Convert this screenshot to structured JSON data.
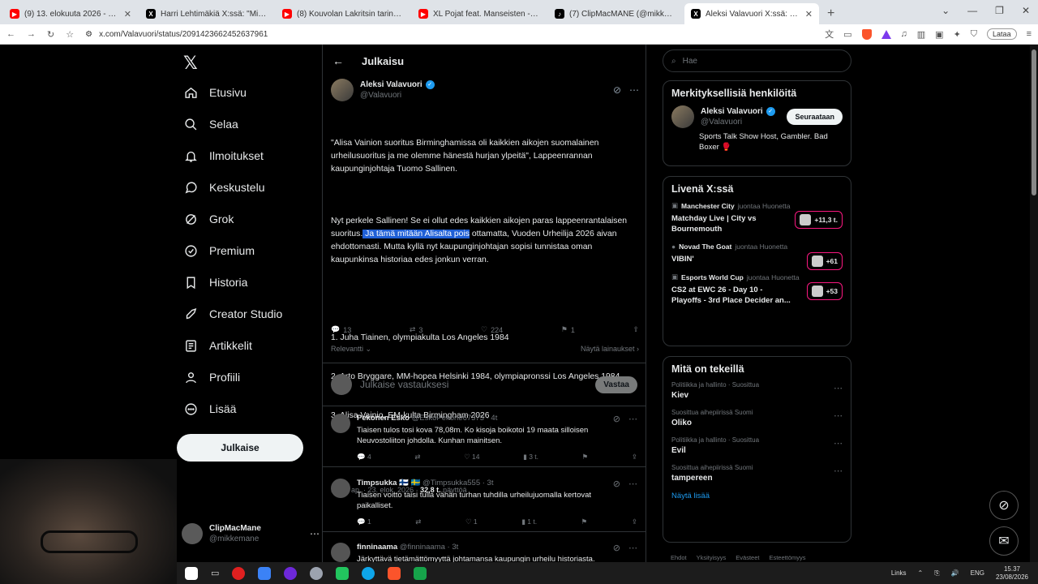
{
  "browser": {
    "tabs": [
      {
        "icon": "youtube-icon",
        "title": "(9) 13. elokuuta 2026 - YouTube",
        "active": false
      },
      {
        "icon": "x-icon",
        "title": "Harri Lehtimäkiä X:ssä: \"Miljoon Su",
        "active": false
      },
      {
        "icon": "youtube-icon",
        "title": "(8) Kouvolan Lakritsin tarina - Tämän",
        "active": false
      },
      {
        "icon": "youtube-icon",
        "title": "XL Pojat feat. Manseisten - aika Pekko",
        "active": false
      },
      {
        "icon": "tiktok-icon",
        "title": "(7) ClipMacMANE (@mikkemane) | Ti",
        "active": false
      },
      {
        "icon": "x-icon",
        "title": "Aleksi Valavuori X:ssä: \"Alisa Va",
        "active": true
      }
    ],
    "url": "x.com/Valavuori/status/2091423662452637961",
    "update_label": "Lataa"
  },
  "nav": {
    "items": [
      {
        "icon": "home-icon",
        "label": "Etusivu"
      },
      {
        "icon": "search-icon",
        "label": "Selaa"
      },
      {
        "icon": "bell-icon",
        "label": "Ilmoitukset"
      },
      {
        "icon": "chat-icon",
        "label": "Keskustelu"
      },
      {
        "icon": "grok-icon",
        "label": "Grok"
      },
      {
        "icon": "premium-icon",
        "label": "Premium"
      },
      {
        "icon": "bookmark-icon",
        "label": "Historia"
      },
      {
        "icon": "rocket-icon",
        "label": "Creator Studio"
      },
      {
        "icon": "article-icon",
        "label": "Artikkelit"
      },
      {
        "icon": "person-icon",
        "label": "Profiili"
      },
      {
        "icon": "more-icon",
        "label": "Lisää"
      }
    ],
    "post_label": "Julkaise",
    "account": {
      "name": "ClipMacMane",
      "handle": "@mikkemane"
    }
  },
  "post": {
    "header": "Julkaisu",
    "author": "Aleksi Valavuori",
    "handle": "@Valavuori",
    "p1": "\"Alisa Vainion suoritus Birminghamissa oli kaikkien aikojen suomalainen urheilusuoritus ja me olemme hänestä hurjan ylpeitä\", Lappeenrannan kaupunginjohtaja Tuomo Sallinen.",
    "p2_a": "Nyt perkele Sallinen! Se ei ollut edes kaikkien aikojen paras lappeenrantalaisen suoritus.",
    "p2_hl": " Ja tämä mitään Alisalta pois",
    "p2_b": " ottamatta, Vuoden Urheilija 2026 aivan ehdottomasti. Mutta kyllä nyt kaupunginjohtajan sopisi tunnistaa oman kaupunkinsa historiaa edes jonkun verran.",
    "list": [
      "1. Juha Tiainen, olympiakulta Los Angeles 1984",
      "2. Arto Bryggare, MM-hopea Helsinki 1984, olympiapronssi Los Angeles 1984.",
      "3. Alisa Vainio, EM-kulta Birmingham 2026"
    ],
    "time": "10.13 ap. · 23. elok. 2026 · ",
    "views": "32,8 t.",
    "views_label": " näyttöä",
    "replies": "13",
    "reposts": "3",
    "likes": "224",
    "bookmarks": "1",
    "sort": "Relevantti",
    "quotes": "Näytä lainaukset",
    "reply_placeholder": "Julkaise vastauksesi",
    "reply_button": "Vastaa"
  },
  "replies": [
    {
      "name": "Pekonen Esko",
      "meta": "@EskoPekone67373 · 4t",
      "text": "Tiaisen tulos tosi kova 78,08m. Ko kisoja boikotoi 19 maata silloisen Neuvostoliiton johdolla. Kunhan mainitsen.",
      "replies": "4",
      "reposts": "",
      "likes": "14",
      "views": "3 t."
    },
    {
      "name": "Timpsukka 🇫🇮 🇸🇪",
      "meta": "@Timpsukka555 · 3t",
      "text": "Tiaisen voitto taisi tulla vähän turhan tuhdilla urheilujuomalla kertovat paikalliset.",
      "replies": "1",
      "reposts": "",
      "likes": "1",
      "views": "1 t."
    },
    {
      "name": "finninaama",
      "meta": "@finninaama · 3t",
      "text": "Järkyttävä tietämättömyyttä johtamansa kaupungin urheilu historiasta.",
      "replies": "",
      "reposts": "",
      "likes": "",
      "views": ""
    }
  ],
  "sidebar": {
    "search_placeholder": "Hae",
    "relevant_title": "Merkityksellisiä henkilöitä",
    "relevant": {
      "name": "Aleksi Valavuori",
      "handle": "@Valavuori",
      "bio": "Sports Talk Show Host, Gambler. Bad Boxer 🥊",
      "follow": "Seuraataan"
    },
    "live_title": "Livenä X:ssä",
    "live": [
      {
        "source": "Manchester City",
        "suffix": "juontaa Huonetta",
        "title": "Matchday Live | City vs Bournemouth",
        "count": "+11,3 t."
      },
      {
        "source": "Novad The Goat",
        "suffix": "juontaa Huonetta",
        "title": "VIBIN'",
        "count": "+61"
      },
      {
        "source": "Esports World Cup",
        "suffix": "juontaa Huonetta",
        "title": "CS2 at EWC 26 - Day 10 - Playoffs - 3rd Place Decider an...",
        "count": "+53"
      }
    ],
    "trends_title": "Mitä on tekeillä",
    "trends": [
      {
        "meta": "Politiikka ja hallinto · Suosittua",
        "name": "Kiev"
      },
      {
        "meta": "Suosittua aihepiirissä Suomi",
        "name": "Oliko"
      },
      {
        "meta": "Politiikka ja hallinto · Suosittua",
        "name": "Evil"
      },
      {
        "meta": "Suosittua aihepiirissä Suomi",
        "name": "tampereen"
      }
    ],
    "show_more": "Näytä lisää",
    "footer": [
      "Ehdot",
      "Yksityisyys",
      "Evästeet",
      "Esteettömyys"
    ]
  },
  "taskbar": {
    "links": "Links",
    "lang": "ENG",
    "time": "15.37",
    "date": "23/08/2026"
  }
}
